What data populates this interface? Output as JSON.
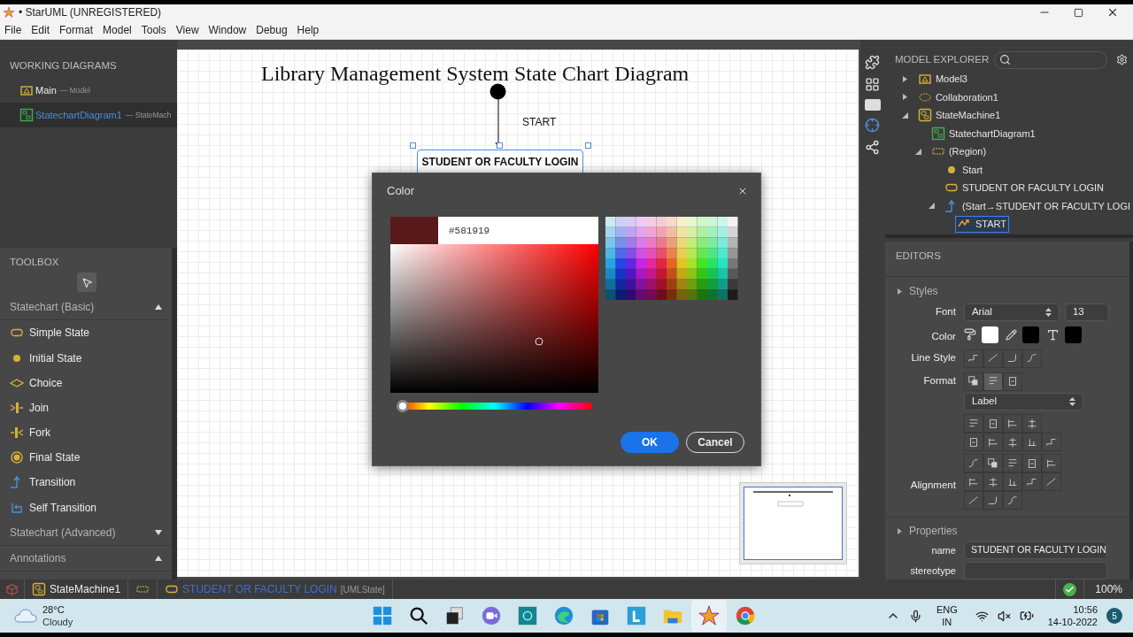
{
  "window": {
    "title": "• StarUML (UNREGISTERED)"
  },
  "menu": [
    "File",
    "Edit",
    "Format",
    "Model",
    "Tools",
    "View",
    "Window",
    "Debug",
    "Help"
  ],
  "working_diagrams": {
    "title": "WORKING DIAGRAMS",
    "items": [
      {
        "name": "Main",
        "type": "— Model",
        "kind": "model",
        "selected": false
      },
      {
        "name": "StatechartDiagram1",
        "type": "— StateMach",
        "kind": "diagram",
        "selected": true
      }
    ]
  },
  "toolbox": {
    "title": "TOOLBOX",
    "sections": [
      {
        "title": "Statechart (Basic)",
        "expanded": true,
        "items": [
          {
            "label": "Simple State",
            "kind": "simple-state"
          },
          {
            "label": "Initial State",
            "kind": "initial-state"
          },
          {
            "label": "Choice",
            "kind": "choice"
          },
          {
            "label": "Join",
            "kind": "join"
          },
          {
            "label": "Fork",
            "kind": "fork"
          },
          {
            "label": "Final State",
            "kind": "final-state"
          },
          {
            "label": "Transition",
            "kind": "transition"
          },
          {
            "label": "Self Transition",
            "kind": "self-transition"
          }
        ]
      },
      {
        "title": "Statechart (Advanced)",
        "expanded": false
      },
      {
        "title": "Annotations",
        "expanded": true
      }
    ]
  },
  "diagram": {
    "title": "Library Management System State Chart Diagram",
    "transition_label": "START",
    "state": {
      "name": "STUDENT OR FACULTY LOGIN",
      "selected": true
    }
  },
  "color_dialog": {
    "title": "Color",
    "hex": "#581919",
    "hue_slider": {
      "level": 0
    },
    "buttons": [
      {
        "label": "OK",
        "kind": "primary"
      },
      {
        "label": "Cancel",
        "kind": "secondary"
      }
    ]
  },
  "model_explorer": {
    "title": "MODEL EXPLORER",
    "tree": [
      {
        "label": "Model3",
        "kind": "model",
        "expanded": false,
        "selected": false
      },
      {
        "label": "Collaboration1",
        "kind": "collaboration",
        "expanded": false,
        "selected": false
      },
      {
        "label": "StateMachine1",
        "kind": "statemachine",
        "expanded": true,
        "selected": false,
        "children": [
          {
            "label": "StatechartDiagram1",
            "kind": "diagram",
            "selected": false
          },
          {
            "label": "(Region)",
            "kind": "region",
            "expanded": true,
            "selected": false,
            "children": [
              {
                "label": "Start",
                "kind": "initial",
                "selected": false
              },
              {
                "label": "STUDENT OR FACULTY LOGIN",
                "kind": "state",
                "selected": false
              },
              {
                "label": "(Start→STUDENT OR FACULTY LOGI",
                "kind": "transition",
                "expanded": true,
                "selected": false,
                "children": [
                  {
                    "label": "START",
                    "kind": "label",
                    "selected": true
                  }
                ]
              }
            ]
          }
        ]
      }
    ]
  },
  "editors": {
    "title": "EDITORS",
    "styles": {
      "title": "Styles",
      "font_label": "Font",
      "font": "Arial",
      "size": "13",
      "color_label": "Color",
      "swatches": [
        {
          "kind": "fill",
          "color": "#ffffff"
        },
        {
          "kind": "line",
          "color": "#000000"
        },
        {
          "kind": "font",
          "color": "#000000"
        }
      ],
      "line_style_label": "Line Style",
      "format_label": "Format",
      "format_tools": [
        {
          "selected": false
        },
        {
          "selected": true
        },
        {
          "selected": false
        }
      ],
      "label_select": "Label",
      "alignment_label": "Alignment"
    },
    "properties": {
      "title": "Properties",
      "rows": [
        {
          "name": "name",
          "value": "STUDENT OR FACULTY LOGIN"
        },
        {
          "name": "stereotype"
        }
      ]
    }
  },
  "status_bar": {
    "items": [
      {
        "kind": "statemachine",
        "label": "StateMachine1"
      },
      {
        "kind": "region"
      },
      {
        "kind": "state",
        "label": "STUDENT OR FACULTY LOGIN",
        "type": "[UMLState]"
      }
    ],
    "zoom": "100%"
  },
  "taskbar": {
    "weather": {
      "temp": "28°C",
      "condition": "Cloudy"
    },
    "apps": [
      {
        "kind": "windows",
        "selected": false
      },
      {
        "kind": "search",
        "selected": false
      },
      {
        "kind": "task-view",
        "selected": false
      },
      {
        "kind": "chat",
        "selected": false
      },
      {
        "kind": "teal-app",
        "selected": false
      },
      {
        "kind": "edge",
        "selected": false
      },
      {
        "kind": "store",
        "selected": false
      },
      {
        "kind": "l-app",
        "selected": false
      },
      {
        "kind": "folder",
        "selected": false
      },
      {
        "kind": "staruml",
        "selected": true
      },
      {
        "kind": "chrome",
        "selected": false
      }
    ],
    "language": [
      "ENG",
      "IN"
    ],
    "time": "10:56",
    "date": "14-10-2022",
    "notifications": "5"
  }
}
